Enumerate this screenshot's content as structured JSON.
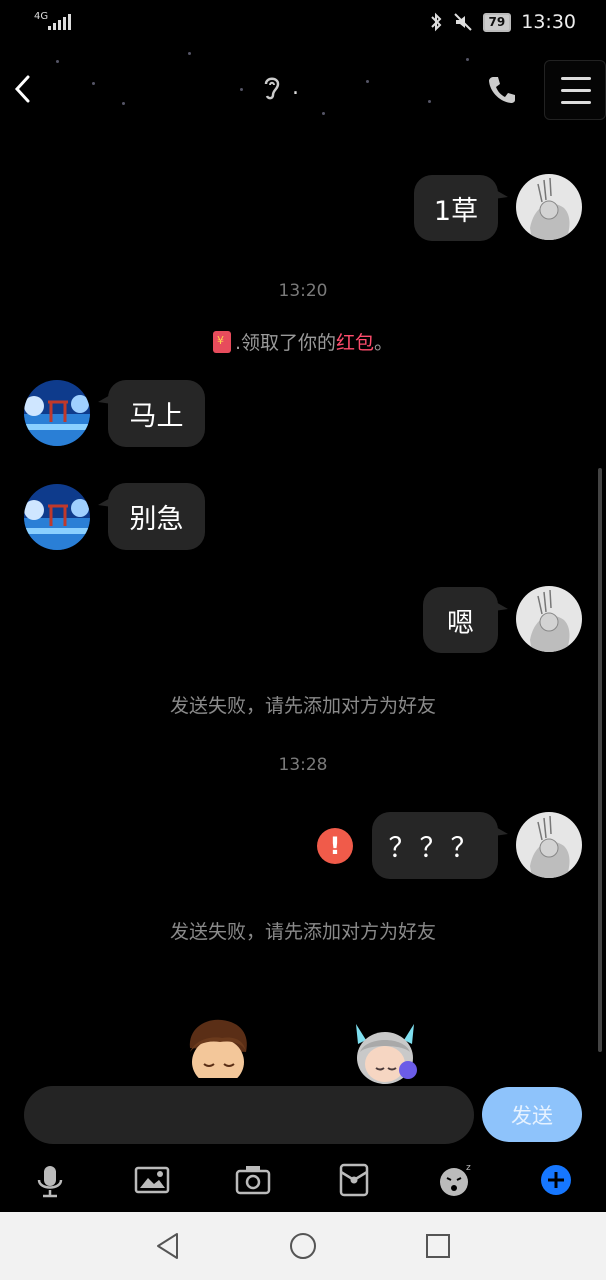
{
  "status_bar": {
    "network": "4G",
    "time": "13:30",
    "battery": "79"
  },
  "header": {
    "title": "."
  },
  "messages": [
    {
      "side": "right",
      "text": "1草"
    },
    {
      "side": "left",
      "text": "马上"
    },
    {
      "side": "left",
      "text": "别急"
    },
    {
      "side": "right",
      "text": "嗯"
    },
    {
      "side": "right",
      "text": "？？？",
      "failed": true
    }
  ],
  "timestamps": [
    "13:20",
    "13:28"
  ],
  "red_packet_notice": {
    "prefix": ".领取了你的",
    "link": "红包",
    "suffix": "。"
  },
  "system_notices": [
    "发送失败，请先添加对方为好友",
    "发送失败，请先添加对方为好友"
  ],
  "input": {
    "placeholder": "",
    "send_label": "发送"
  },
  "toolbar": {
    "icons": [
      "microphone-icon",
      "image-icon",
      "camera-icon",
      "red-packet-icon",
      "emoji-icon",
      "plus-icon"
    ]
  },
  "nav_bar": {
    "icons": [
      "back-triangle-icon",
      "home-circle-icon",
      "recents-square-icon"
    ]
  },
  "colors": {
    "bubble": "#262626",
    "send_button": "#8ec3fb",
    "accent_link": "#ff4d6d",
    "error": "#f05b4a",
    "plus": "#1677ff"
  }
}
